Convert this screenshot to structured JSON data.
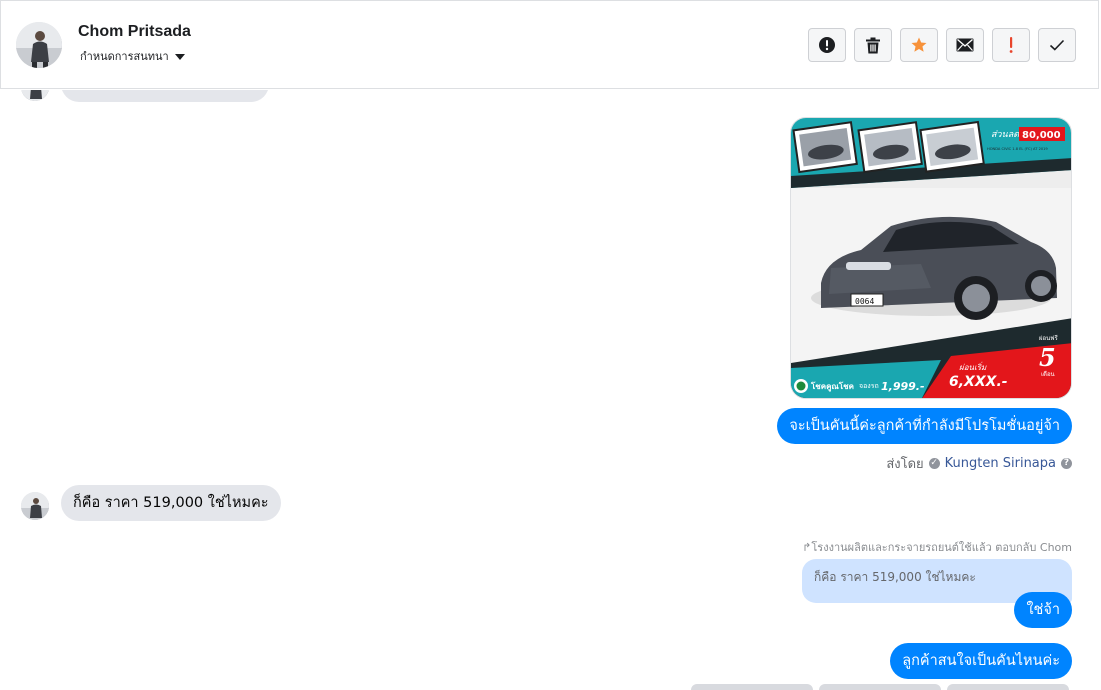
{
  "header": {
    "contact_name": "Chom Pritsada",
    "assign_label": "กำหนดการสนทนา",
    "actions": [
      {
        "icon": "alert-circle-icon",
        "name": "mark-spam-button"
      },
      {
        "icon": "trash-icon",
        "name": "delete-button"
      },
      {
        "icon": "star-icon",
        "name": "star-button"
      },
      {
        "icon": "envelope-icon",
        "name": "mark-unread-button"
      },
      {
        "icon": "exclamation-icon",
        "name": "follow-up-button"
      },
      {
        "icon": "check-icon",
        "name": "mark-done-button"
      }
    ],
    "colors": {
      "star": "#f7923a",
      "exclamation": "#e8452c",
      "icon": "#1c1e21"
    }
  },
  "messages": {
    "promo_text": "จะเป็นคันนี้ค่ะลูกค้าที่กำลังมีโปรโมชั่นอยู่จ้า",
    "sent_by_label": "ส่งโดย",
    "sent_by_agent": "Kungten Sirinapa",
    "customer_question": "ก็คือ ราคา 519,000 ใช่ไหมคะ",
    "reply_meta": "โรงงานผลิตและกระจายรถยนต์ใช้แล้ว ตอบกลับ Chom",
    "quoted_text": "ก็คือ ราคา 519,000 ใช่ไหมคะ",
    "reply_yes": "ใช่จ้า",
    "followup_question": "ลูกค้าสนใจเป็นคันไหนค่ะ"
  },
  "car_ad": {
    "discount_label": "ส่วนลด",
    "discount_value": "80,000",
    "model_text": "HONDA CIVIC 1.8 EL (FC) AT 2019",
    "plate": "0064",
    "down_label": "ผ่อนเริ่ม",
    "down_value": "6,XXX.-",
    "booking_label": "จองรถ",
    "booking_value": "1,999.-",
    "free_label": "ผ่อนฟรี",
    "free_months": "5",
    "months_label": "เดือน",
    "brand_text": "โชคคูณโชค",
    "colors": {
      "teal": "#1aa7b0",
      "red": "#e3161b",
      "dark": "#1e2a2e"
    }
  },
  "colors": {
    "outgoing": "#0084ff",
    "incoming": "#e4e6eb",
    "quote": "#cfe3ff"
  }
}
